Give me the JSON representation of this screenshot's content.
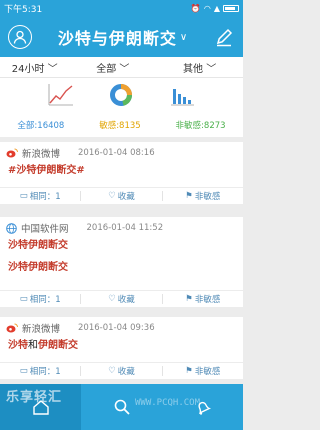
{
  "status": {
    "time": "下午5:31"
  },
  "header": {
    "title": "沙特与伊朗断交",
    "title_chevron": "∨"
  },
  "filters": [
    {
      "label": "24小时"
    },
    {
      "label": "全部"
    },
    {
      "label": "其他"
    }
  ],
  "stats": {
    "all": "全部:16408",
    "sensitive": "敏感:8135",
    "non_sensitive": "非敏感:8273"
  },
  "cards": [
    {
      "source": "新浪微博",
      "date": "2016-01-04 08:16",
      "lines": [
        "#沙特伊朗断交#"
      ]
    },
    {
      "source": "中国软件网",
      "date": "2016-01-04 11:52",
      "lines": [
        "沙特伊朗断交",
        "沙特伊朗断交"
      ]
    },
    {
      "source": "新浪微博",
      "date": "2016-01-04 09:36",
      "line3_a": "沙特",
      "line3_b": "和",
      "line3_c": "伊朗断交"
    }
  ],
  "actions": {
    "same": "相同：1",
    "favorite": "收藏",
    "non_sensitive": "非敏感"
  },
  "watermark": {
    "text": "乐享轻汇",
    "url": "WWW.PCQH.COM"
  },
  "colors": {
    "primary": "#2aa3d9",
    "highlight": "#c43c2c"
  }
}
